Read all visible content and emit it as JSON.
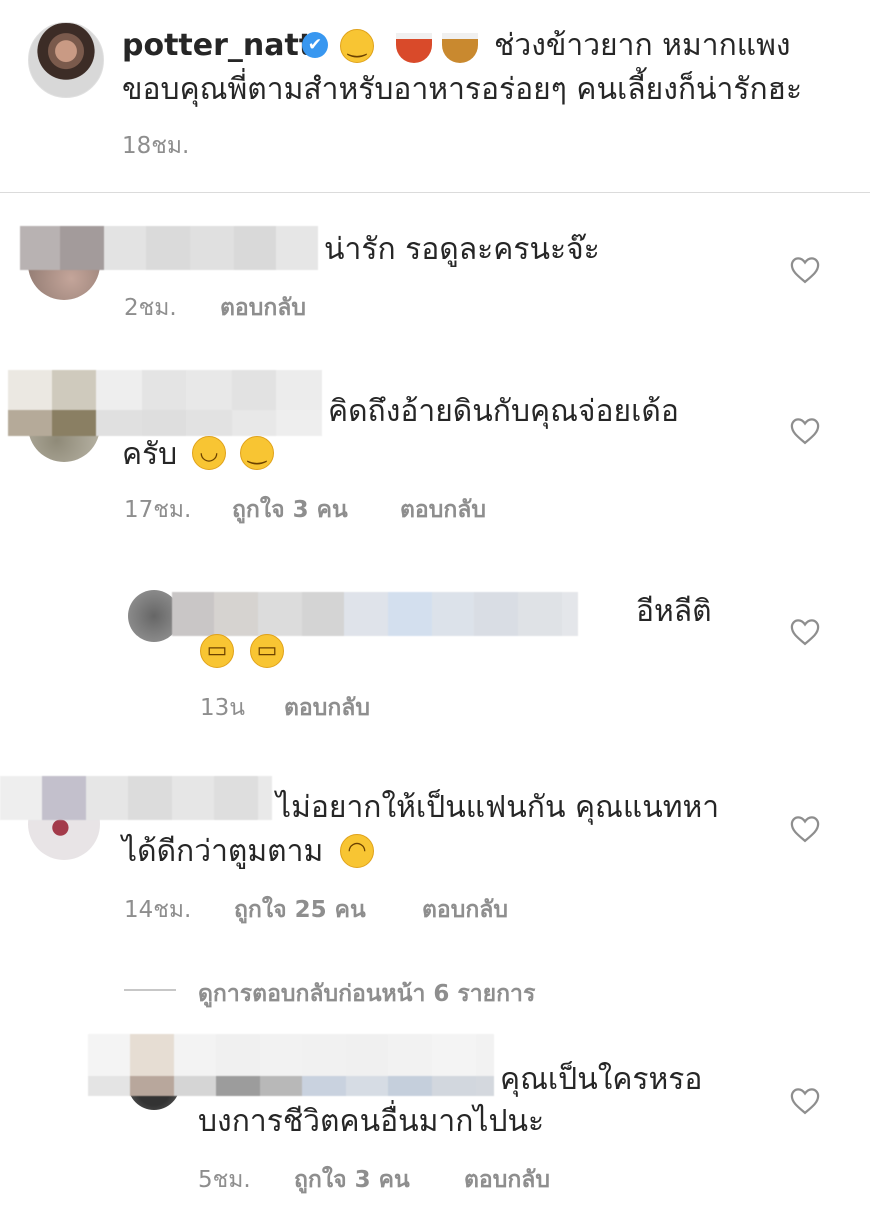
{
  "post": {
    "username": "potter_natt",
    "caption_line1": "ช่วงข้าวยาก หมากแพง",
    "caption_line2": "ขอบคุณพี่ตามสำหรับอาหารอร่อยๆ คนเลี้ยงก็น่ารักฮะ",
    "time": "18ชม.",
    "verified_icon": "✔",
    "emoji_icons": [
      "yum-face-emoji",
      "spaghetti-emoji",
      "curry-rice-emoji"
    ]
  },
  "comments": [
    {
      "text_line1": "น่ารัก รอดูละครนะจ๊ะ",
      "time": "2ชม.",
      "reply": "ตอบกลับ"
    },
    {
      "text_line1": "คิดถึงอ้ายดินกับคุณจ่อยเด้อ",
      "text_line2": "ครับ",
      "time": "17ชม.",
      "likes": "ถูกใจ 3 คน",
      "reply": "ตอบกลับ",
      "emojis": [
        "smiling-face-emoji",
        "winking-face-emoji"
      ]
    },
    {
      "text_line1": "อีหลีติ",
      "time": "13น",
      "reply": "ตอบกลับ",
      "emojis": [
        "grinning-face-emoji",
        "grinning-face-emoji"
      ]
    },
    {
      "text_line1": "ไม่อยากให้เป็นแฟนกัน คุณแนทหา",
      "text_line2": "ได้ดีกว่าตูมตาม",
      "time": "14ชม.",
      "likes": "ถูกใจ 25 คน",
      "reply": "ตอบกลับ",
      "emojis": [
        "pleading-face-emoji"
      ]
    },
    {
      "text_line1": "คุณเป็นใครหรอ",
      "text_line2": "บงการชีวิตคนอื่นมากไปนะ",
      "time": "5ชม.",
      "likes": "ถูกใจ 3 คน",
      "reply": "ตอบกลับ"
    }
  ],
  "view_replies": "ดูการตอบกลับก่อนหน้า 6 รายการ",
  "colors": {
    "text": "#262626",
    "meta": "#8e8e8e",
    "verified": "#3897f0",
    "divider": "#dbdbdb"
  },
  "icons": {
    "heart": "heart-outline-icon"
  }
}
